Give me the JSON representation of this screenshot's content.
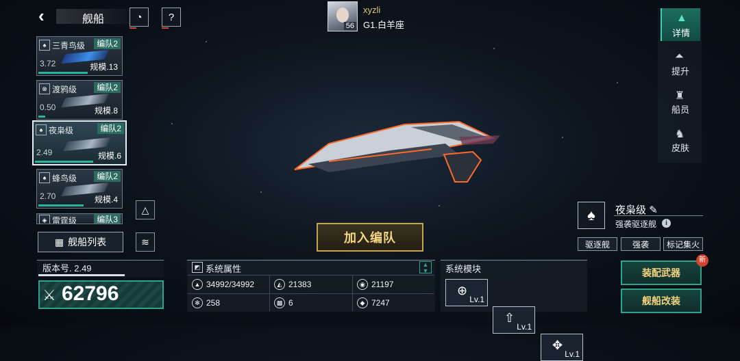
{
  "header": {
    "title": "舰船",
    "back_icon": "back-arrow-icon"
  },
  "player": {
    "name": "xyzli",
    "level": "56",
    "rank": "G1.白羊座"
  },
  "ship_list": [
    {
      "name": "三青鸟级",
      "badge": "编队2",
      "value": "3.72",
      "scale": "规模.13",
      "progress": 0.6,
      "selected": false
    },
    {
      "name": "渡鸦级",
      "badge": "编队2",
      "value": "0.50",
      "scale": "规模.8",
      "progress": 0.08,
      "selected": false
    },
    {
      "name": "夜枭级",
      "badge": "编队2",
      "value": "2.49",
      "scale": "规模.6",
      "progress": 0.65,
      "selected": true
    },
    {
      "name": "蜂鸟级",
      "badge": "编队2",
      "value": "2.70",
      "scale": "规模.4",
      "progress": 0.55,
      "selected": false
    },
    {
      "name": "雷霆级",
      "badge": "编队3",
      "value": "",
      "scale": "",
      "progress": 0,
      "selected": false
    }
  ],
  "list_button": "舰船列表",
  "version": {
    "label": "版本号. 2.49",
    "progress": 0.69
  },
  "power": "62796",
  "join_button": "加入编队",
  "stats": {
    "title": "系统属性",
    "items": [
      {
        "icon": "hull-icon",
        "value": "34992/34992"
      },
      {
        "icon": "armor-icon",
        "value": "21383"
      },
      {
        "icon": "shield-icon",
        "value": "21197"
      },
      {
        "icon": "energy-icon",
        "value": "258"
      },
      {
        "icon": "grid-icon",
        "value": "6"
      },
      {
        "icon": "speed-icon",
        "value": "7247"
      }
    ]
  },
  "modules": {
    "title": "系统模块",
    "slots": [
      {
        "icon": "target-module-icon",
        "level": "Lv.1"
      },
      {
        "icon": "missile-module-icon",
        "level": "Lv.1"
      },
      {
        "icon": "drone-module-icon",
        "level": "Lv.1"
      }
    ]
  },
  "tabs": [
    "详情",
    "提升",
    "船员",
    "皮肤"
  ],
  "ship_info": {
    "name": "夜枭级",
    "type": "强袭驱逐舰",
    "tags": [
      "驱逐舰",
      "强袭",
      "标记集火"
    ]
  },
  "actions": {
    "equip": "装配武器",
    "modify": "舰船改装",
    "new_badge": "新"
  },
  "colors": {
    "accent": "#2fa48d",
    "gold": "#c8a54a",
    "highlight": "#e3c873"
  }
}
